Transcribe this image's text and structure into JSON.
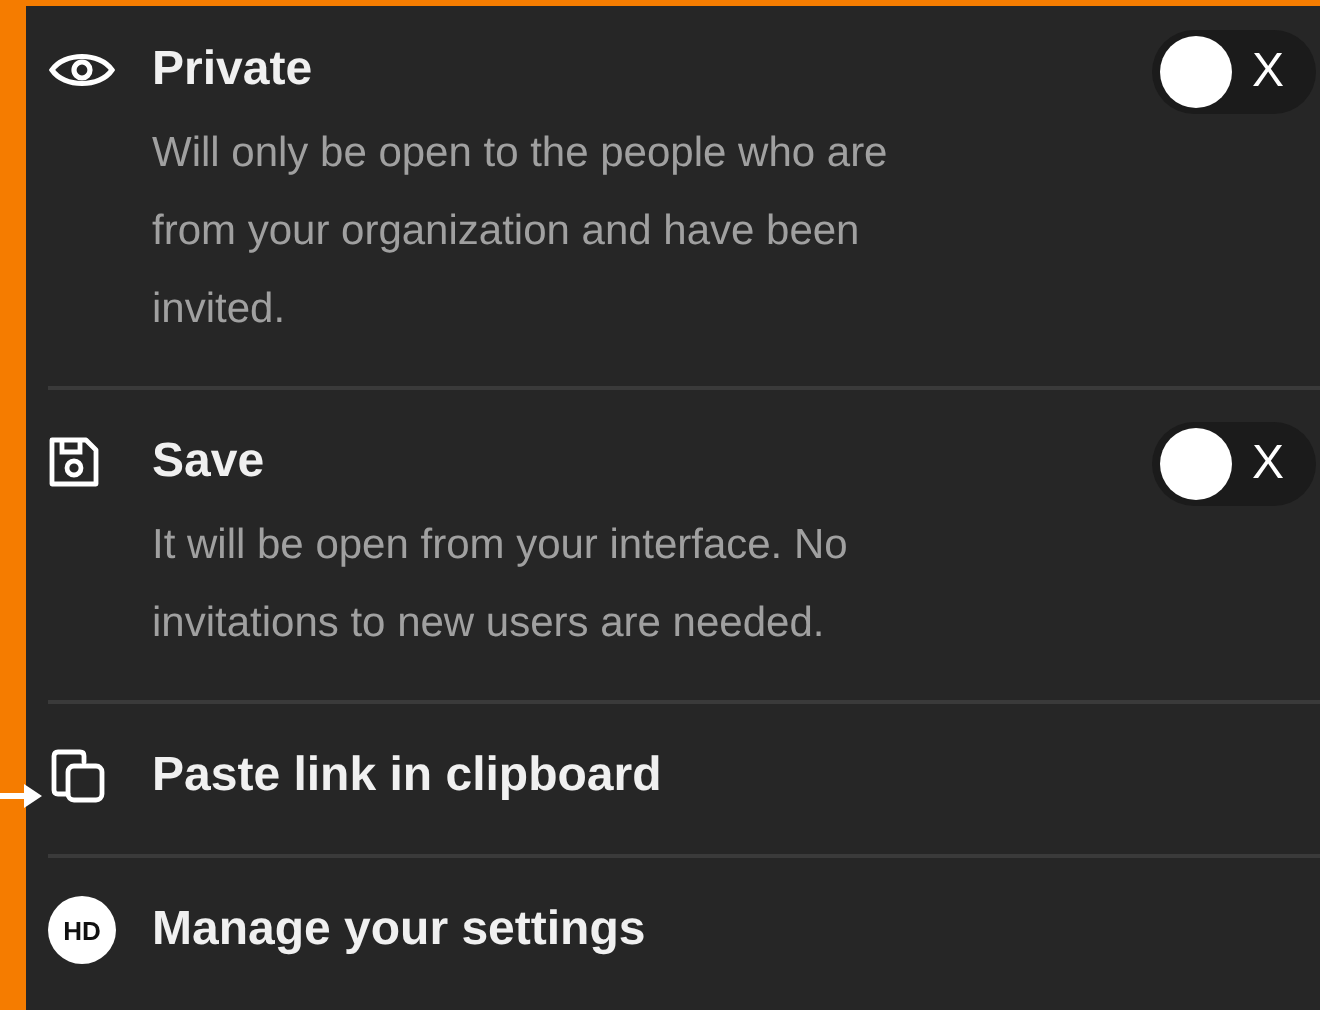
{
  "items": [
    {
      "kind": "toggle",
      "title": "Private",
      "description": "Will only be open to the people who are from your organization and have been invited.",
      "toggle": {
        "on": false,
        "label": "X"
      }
    },
    {
      "kind": "toggle",
      "title": "Save",
      "description": "It will be open from your interface. No invitations to new users are needed.",
      "toggle": {
        "on": false,
        "label": "X"
      }
    },
    {
      "kind": "action",
      "title": "Paste link in clipboard"
    },
    {
      "kind": "avatar",
      "avatar": "HD",
      "title": "Manage your settings"
    }
  ]
}
